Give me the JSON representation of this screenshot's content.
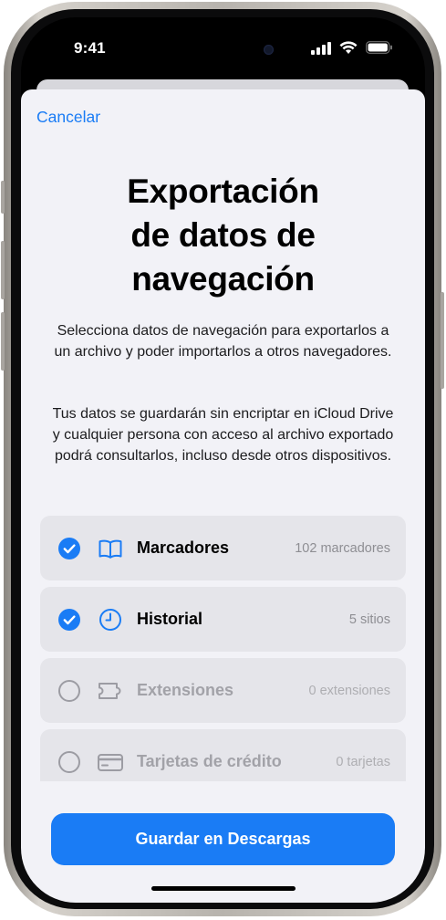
{
  "status_bar": {
    "time": "9:41"
  },
  "sheet": {
    "cancel_label": "Cancelar",
    "title_lines": [
      "Exportación",
      "de datos de",
      "navegación"
    ],
    "description_1": "Selecciona datos de navegación para exportarlos a un archivo y poder importarlos a otros navegadores.",
    "description_2": "Tus datos se guardarán sin encriptar en iCloud Drive y cualquier persona con acceso al archivo exportado podrá consultarlos, incluso desde otros dispositivos.",
    "items": [
      {
        "label": "Marcadores",
        "count": "102 marcadores",
        "checked": true,
        "icon": "book-icon"
      },
      {
        "label": "Historial",
        "count": "5 sitios",
        "checked": true,
        "icon": "clock-icon"
      },
      {
        "label": "Extensiones",
        "count": "0 extensiones",
        "checked": false,
        "icon": "puzzle-icon"
      },
      {
        "label": "Tarjetas de crédito",
        "count": "0 tarjetas",
        "checked": false,
        "icon": "credit-card-icon"
      }
    ],
    "save_button_label": "Guardar en Descargas"
  },
  "colors": {
    "accent": "#1a7cf5",
    "sheet_bg": "#f2f2f7",
    "row_bg": "#e5e5ea"
  }
}
